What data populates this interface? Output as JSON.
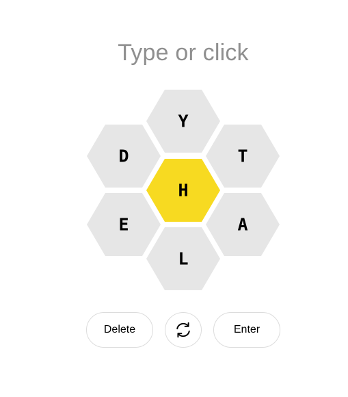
{
  "input": {
    "placeholder": "Type or click"
  },
  "hive": {
    "center_letter": "H",
    "outer_letters": {
      "top": "Y",
      "upper_left": "D",
      "upper_right": "T",
      "lower_left": "E",
      "lower_right": "A",
      "bottom": "L"
    },
    "cell_color": "#e6e6e6",
    "center_color": "#f7da21"
  },
  "controls": {
    "delete_label": "Delete",
    "shuffle_icon": "shuffle-icon",
    "enter_label": "Enter"
  }
}
